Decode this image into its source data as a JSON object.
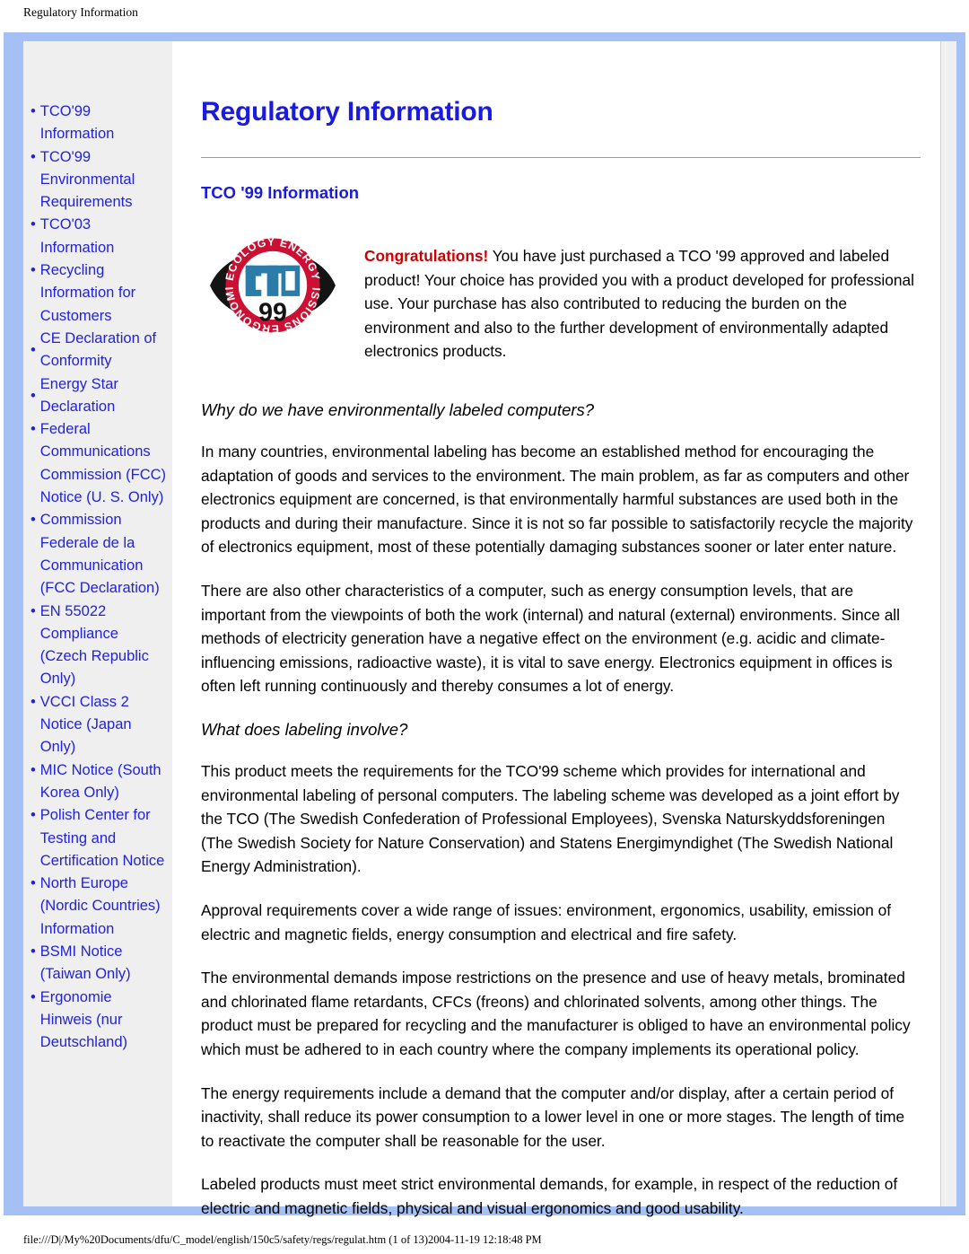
{
  "print": {
    "header_title": "Regulatory Information",
    "footer_path": "file:///D|/My%20Documents/dfu/C_model/english/150c5/safety/regs/regulat.htm (1 of 13)2004-11-19 12:18:48 PM"
  },
  "colors": {
    "frame_blue": "#a4c0f4",
    "sidebar_grey": "#efefef",
    "link_blue": "#2222dd",
    "heading_blue": "#1b1be0",
    "congrats_red": "#cc0000",
    "logo_red": "#cc1033",
    "logo_teal": "#2b7ca8"
  },
  "sidebar": {
    "items": [
      {
        "label": "TCO'99 Information",
        "bullet_mid": false
      },
      {
        "label": "TCO'99 Environmental Requirements",
        "bullet_mid": false
      },
      {
        "label": "TCO'03 Information",
        "bullet_mid": false
      },
      {
        "label": "Recycling Information for Customers",
        "bullet_mid": false
      },
      {
        "label": "CE Declaration of Conformity",
        "bullet_mid": true
      },
      {
        "label": "Energy Star Declaration",
        "bullet_mid": true
      },
      {
        "label": "Federal Communications Commission (FCC) Notice (U. S. Only)",
        "bullet_mid": false
      },
      {
        "label": "Commission Federale de la Communication (FCC Declaration)",
        "bullet_mid": false
      },
      {
        "label": "EN 55022 Compliance (Czech Republic Only)",
        "bullet_mid": false
      },
      {
        "label": "VCCI Class 2 Notice (Japan Only)",
        "bullet_mid": false
      },
      {
        "label": "MIC Notice (South Korea Only)",
        "bullet_mid": false
      },
      {
        "label": "Polish Center for Testing and Certification Notice",
        "bullet_mid": false
      },
      {
        "label": "North Europe (Nordic Countries) Information",
        "bullet_mid": false
      },
      {
        "label": "BSMI Notice (Taiwan Only)",
        "bullet_mid": false
      },
      {
        "label": "Ergonomie Hinweis (nur Deutschland)",
        "bullet_mid": false
      }
    ],
    "bullet_glyph": "•"
  },
  "main": {
    "page_title": "Regulatory Information",
    "section_heading": "TCO '99 Information",
    "logo": {
      "alt": "TCO 99 certification logo",
      "top_arc_text": "ECOLOGY ENERGY",
      "bottom_arc_text": "EMISSIONS ERGONOMICS",
      "center_word": "TCO",
      "center_year": "99"
    },
    "intro": {
      "congrats": "Congratulations!",
      "rest": " You have just purchased a TCO '99 approved and labeled product! Your choice has provided you with a product developed for professional use. Your purchase has also contributed to reducing the burden on the environment and also to the further development of environmentally adapted electronics products."
    },
    "subhead_1": "Why do we have environmentally labeled computers?",
    "para_1": "In many countries, environmental labeling has become an established method for encouraging the adaptation of goods and services to the environment. The main problem, as far as computers and other electronics equipment are concerned, is that environmentally harmful substances are used both in the products and during their manufacture. Since it is not so far possible to satisfactorily recycle the majority of electronics equipment, most of these potentially damaging substances sooner or later enter nature.",
    "para_2": "There are also other characteristics of a computer, such as energy consumption levels, that are important from the viewpoints of both the work (internal) and natural (external) environments. Since all methods of electricity generation have a negative effect on the environment (e.g. acidic and climate-influencing emissions, radioactive waste), it is vital to save energy. Electronics equipment in offices is often left running continuously and thereby consumes a lot of energy.",
    "subhead_2": "What does labeling involve?",
    "para_3": "This product meets the requirements for the TCO'99 scheme which provides for international and environmental labeling of personal computers. The labeling scheme was developed as a joint effort by the TCO (The Swedish Confederation of Professional Employees), Svenska Naturskyddsforeningen (The Swedish Society for Nature Conservation) and Statens Energimyndighet (The Swedish National Energy Administration).",
    "para_4": "Approval requirements cover a wide range of issues: environment, ergonomics, usability, emission of electric and magnetic fields, energy consumption and electrical and fire safety.",
    "para_5": "The environmental demands impose restrictions on the presence and use of heavy metals, brominated and chlorinated flame retardants, CFCs (freons) and chlorinated solvents, among other things. The product must be prepared for recycling and the manufacturer is obliged to have an environmental policy which must be adhered to in each country where the company implements its operational policy.",
    "para_6": "The energy requirements include a demand that the computer and/or display, after a certain period of inactivity, shall reduce its power consumption to a lower level in one or more stages. The length of time to reactivate the computer shall be reasonable for the user.",
    "para_7": "Labeled products must meet strict environmental demands, for example, in respect of the reduction of electric and magnetic fields, physical and visual ergonomics and good usability."
  }
}
